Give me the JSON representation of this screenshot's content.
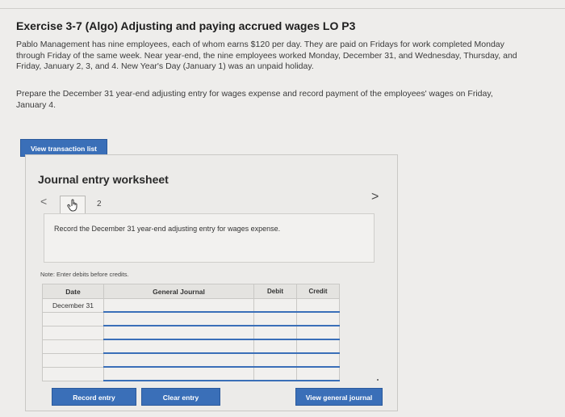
{
  "exercise": {
    "title": "Exercise 3-7 (Algo) Adjusting and paying accrued wages LO P3",
    "paragraph1_line1": "Pablo Management has nine employees, each of whom earns $120 per day. They are paid on Fridays for work completed Monday",
    "paragraph1_line2": "through Friday of the same week. Near year-end, the nine employees worked Monday, December 31, and Wednesday, Thursday, and",
    "paragraph1_line3": "Friday, January 2, 3, and 4. New Year's Day (January 1) was an unpaid holiday.",
    "paragraph2_line1": "Prepare the December 31 year-end adjusting entry for wages expense and record payment of the employees' wages on Friday,",
    "paragraph2_line2": "January 4.",
    "view_transaction_list_label": "View transaction list"
  },
  "worksheet": {
    "title": "Journal entry worksheet",
    "prev_arrow": "<",
    "next_arrow": ">",
    "page_number": "2",
    "instruction": "Record the December 31 year-end adjusting entry for wages expense.",
    "note": "Note: Enter debits before credits.",
    "table": {
      "headers": [
        "Date",
        "General Journal",
        "Debit",
        "Credit"
      ],
      "date_value": "December 31"
    },
    "buttons": {
      "record": "Record entry",
      "clear": "Clear entry",
      "view_journal": "View general journal"
    }
  },
  "colors": {
    "accent": "#3a6fb8",
    "background": "#eeedeb"
  },
  "icons": [
    "hand-pointer-icon"
  ]
}
